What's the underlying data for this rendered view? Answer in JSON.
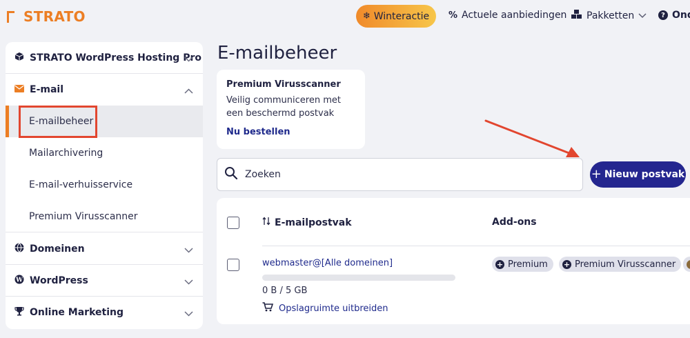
{
  "header": {
    "logo_text": "STRATO",
    "promo_label": "Winteractie",
    "nav": [
      {
        "label": "Actuele aanbiedingen",
        "icon": "percent-icon"
      },
      {
        "label": "Pakketten",
        "icon": "cubes-icon"
      },
      {
        "label": "Ond",
        "icon": "help-circle-icon"
      }
    ]
  },
  "sidebar": {
    "sections": [
      {
        "label": "STRATO WordPress Hosting Pro",
        "icon": "box-icon",
        "expanded": false
      },
      {
        "label": "E-mail",
        "icon": "mail-icon",
        "expanded": true
      },
      {
        "label": "Domeinen",
        "icon": "globe-icon",
        "expanded": false
      },
      {
        "label": "WordPress",
        "icon": "wordpress-icon",
        "expanded": false
      },
      {
        "label": "Online Marketing",
        "icon": "trophy-icon",
        "expanded": false
      }
    ],
    "email_items": [
      {
        "label": "E-mailbeheer",
        "active": true
      },
      {
        "label": "Mailarchivering",
        "active": false
      },
      {
        "label": "E-mail-verhuisservice",
        "active": false
      },
      {
        "label": "Premium Virusscanner",
        "active": false
      }
    ]
  },
  "main": {
    "title": "E-mailbeheer",
    "promo_card": {
      "title": "Premium Virusscanner",
      "text": "Veilig communiceren met een beschermd postvak",
      "link": "Nu bestellen"
    },
    "search": {
      "placeholder": "Zoeken"
    },
    "new_button": "Nieuw postvak",
    "table": {
      "columns": [
        "E-mailpostvak",
        "Add-ons"
      ],
      "rows": [
        {
          "email": "webmaster@[Alle domeinen]",
          "storage_text": "0 B / 5 GB",
          "storage_fraction": 0,
          "expand_label": "Opslagruimte uitbreiden",
          "addons": [
            "Premium",
            "Premium Virusscanner"
          ]
        }
      ]
    }
  },
  "colors": {
    "brand_orange": "#ec7e24",
    "primary_blue": "#24268f",
    "link_blue": "#1f2a8c",
    "annotation_red": "#e2462f"
  }
}
